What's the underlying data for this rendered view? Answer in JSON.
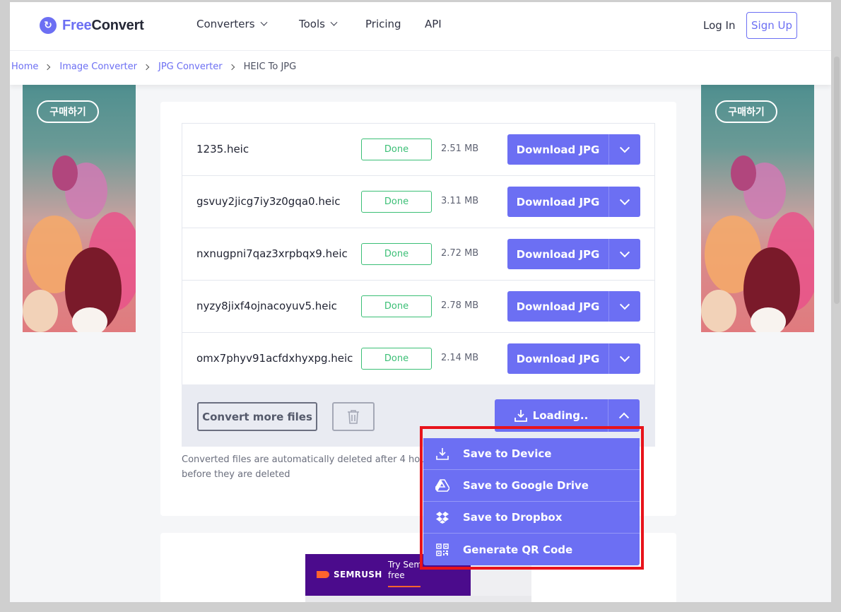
{
  "header": {
    "logo_free": "Free",
    "logo_convert": "Convert",
    "nav": [
      "Converters",
      "Tools",
      "Pricing",
      "API"
    ],
    "login": "Log In",
    "signup": "Sign Up"
  },
  "breadcrumb": {
    "items": [
      "Home",
      "Image Converter",
      "JPG Converter"
    ],
    "current": "HEIC To JPG"
  },
  "ads": {
    "button": "구매하기"
  },
  "files": [
    {
      "name": "1235.heic",
      "status": "Done",
      "size": "2.51 MB",
      "action": "Download JPG"
    },
    {
      "name": "gsvuy2jicg7iy3z0gqa0.heic",
      "status": "Done",
      "size": "3.11 MB",
      "action": "Download JPG"
    },
    {
      "name": "nxnugpni7qaz3xrpbqx9.heic",
      "status": "Done",
      "size": "2.72 MB",
      "action": "Download JPG"
    },
    {
      "name": "nyzy8jixf4ojnacoyuv5.heic",
      "status": "Done",
      "size": "2.78 MB",
      "action": "Download JPG"
    },
    {
      "name": "omx7phyv91acfdxhyxpg.heic",
      "status": "Done",
      "size": "2.14 MB",
      "action": "Download JPG"
    }
  ],
  "footer": {
    "convert_more": "Convert more files",
    "loading": "Loading..",
    "note_line1": "Converted files are automatically deleted after 4 hours",
    "note_line2": "before they are deleted"
  },
  "menu": {
    "items": [
      {
        "label": "Save to Device",
        "icon": "download-icon"
      },
      {
        "label": "Save to Google Drive",
        "icon": "google-drive-icon"
      },
      {
        "label": "Save to Dropbox",
        "icon": "dropbox-icon"
      },
      {
        "label": "Generate QR Code",
        "icon": "qr-code-icon"
      }
    ]
  },
  "semrush_ad": {
    "brand": "SEMRUSH",
    "try_text": "Try Sem",
    "free_text": "free"
  },
  "colors": {
    "accent": "#6c6ff3",
    "done": "#3bbf76",
    "highlight": "#e8131b"
  }
}
